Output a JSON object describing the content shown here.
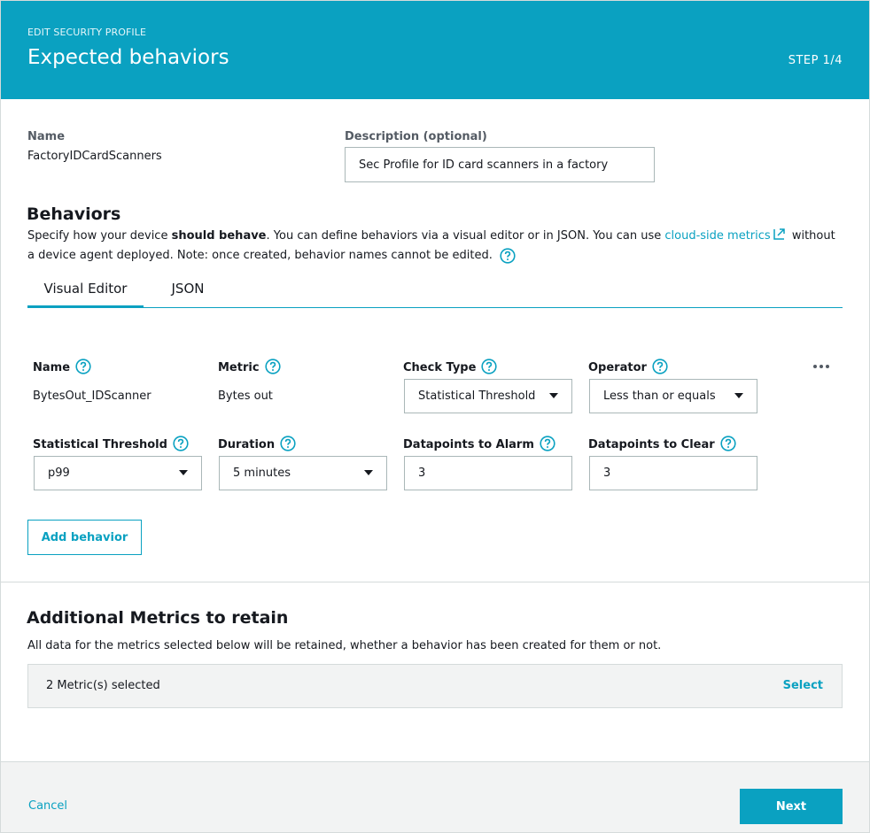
{
  "header": {
    "eyebrow": "EDIT SECURITY PROFILE",
    "title": "Expected behaviors",
    "step": "STEP 1/4"
  },
  "profile": {
    "name_label": "Name",
    "name_value": "FactoryIDCardScanners",
    "description_label": "Description (optional)",
    "description_value": "Sec Profile for ID card scanners in a factory"
  },
  "behaviors": {
    "title": "Behaviors",
    "desc_part1": "Specify how your device ",
    "desc_bold": "should behave",
    "desc_part2": ". You can define behaviors via a visual editor or in JSON. You can use ",
    "desc_link": "cloud-side metrics",
    "desc_part3": " without a device agent deployed. Note: once created, behavior names cannot be edited.",
    "tabs": [
      {
        "label": "Visual Editor",
        "active": true
      },
      {
        "label": "JSON",
        "active": false
      }
    ],
    "behavior": {
      "name_label": "Name",
      "name_value": "BytesOut_IDScanner",
      "metric_label": "Metric",
      "metric_value": "Bytes out",
      "check_type_label": "Check Type",
      "check_type_value": "Statistical Threshold",
      "operator_label": "Operator",
      "operator_value": "Less than or equals",
      "stat_threshold_label": "Statistical Threshold",
      "stat_threshold_value": "p99",
      "duration_label": "Duration",
      "duration_value": "5 minutes",
      "dp_alarm_label": "Datapoints to Alarm",
      "dp_alarm_value": "3",
      "dp_clear_label": "Datapoints to Clear",
      "dp_clear_value": "3"
    },
    "add_behavior_label": "Add behavior"
  },
  "metrics": {
    "title": "Additional Metrics to retain",
    "desc": "All data for the metrics selected below will be retained, whether a behavior has been created for them or not.",
    "selected_text": "2 Metric(s) selected",
    "select_label": "Select"
  },
  "footer": {
    "cancel_label": "Cancel",
    "next_label": "Next"
  },
  "colors": {
    "accent": "#0aa1c1",
    "text": "#16191f",
    "muted": "#545b64",
    "border": "#aab7b8",
    "panel": "#f2f3f3"
  },
  "icons": [
    "help-icon",
    "external-link-icon",
    "caret-down-icon",
    "more-options-icon"
  ]
}
